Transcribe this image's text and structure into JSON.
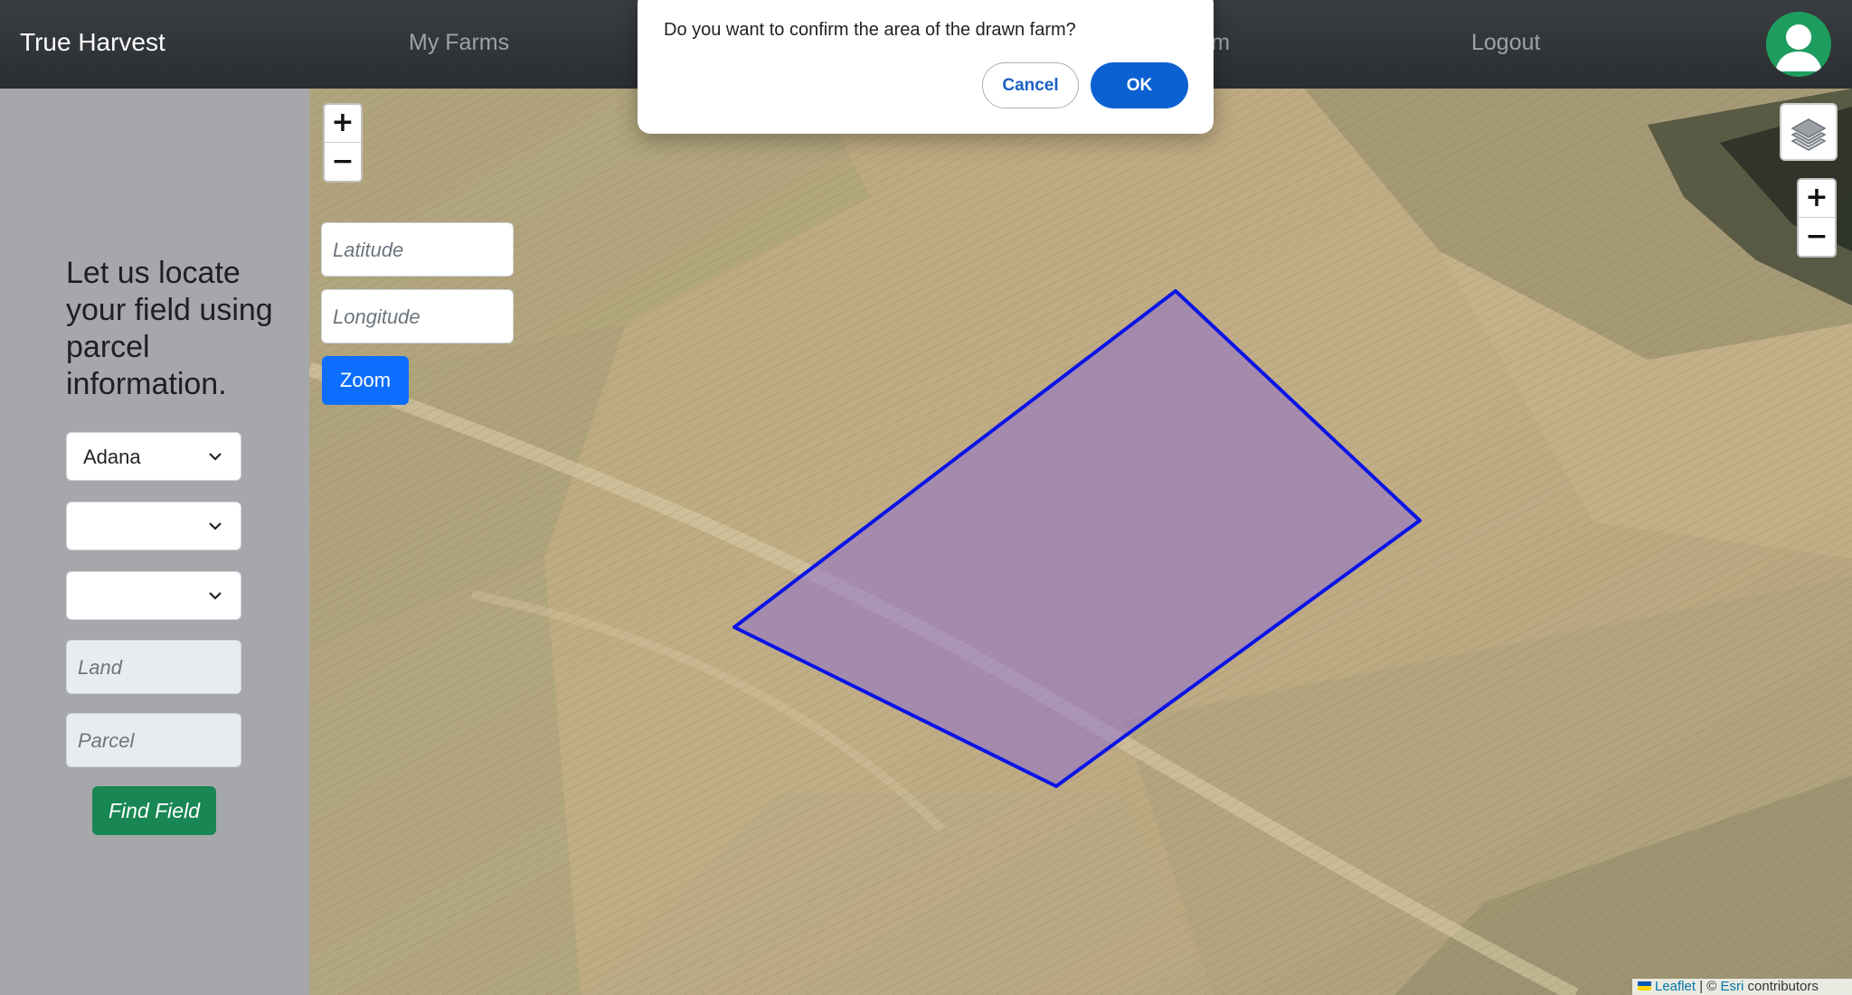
{
  "navbar": {
    "brand": "True Harvest",
    "links": [
      "My Farms",
      "arm",
      "Logout"
    ]
  },
  "sidebar": {
    "title": "Let us locate your field using parcel information.",
    "province_select": "Adana",
    "district_select": "",
    "neighborhood_select": "",
    "land_placeholder": "Land",
    "parcel_placeholder": "Parcel",
    "find_button": "Find Field"
  },
  "map": {
    "latitude_placeholder": "Latitude",
    "longitude_placeholder": "Longitude",
    "zoom_button": "Zoom",
    "zoom_in": "+",
    "zoom_out": "−",
    "attribution": {
      "leaflet": "Leaflet",
      "separator": " | © ",
      "esri": "Esri",
      "suffix": " contributors"
    },
    "polygon_stroke": "#0a14e6",
    "polygon_fill": "#8a6ad8"
  },
  "dialog": {
    "message": "Do you want to confirm the area of the drawn farm?",
    "cancel": "Cancel",
    "ok": "OK"
  },
  "icons": {
    "avatar": "user-icon",
    "layers": "layers-icon",
    "select_arrow": "chevron-down-icon"
  },
  "colors": {
    "navbar": "#2f3236",
    "sidebar": "#a6a7ab",
    "find_button": "#198754",
    "zoom_button": "#0d6efd",
    "dialog_ok": "#0b61d1"
  }
}
